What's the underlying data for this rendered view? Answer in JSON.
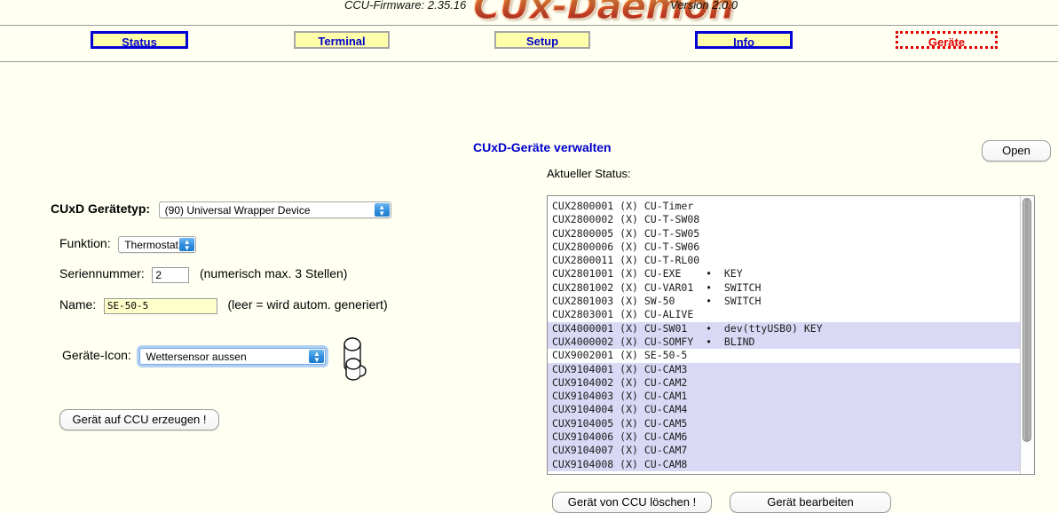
{
  "header": {
    "firmware": "CCU-Firmware: 2.35.16",
    "logo": "CUx-Daemon",
    "version": "Version 2.0.0"
  },
  "nav": {
    "tabs": [
      {
        "label": "Status",
        "state": "active"
      },
      {
        "label": "Terminal",
        "state": "plain"
      },
      {
        "label": "Setup",
        "state": "plain"
      },
      {
        "label": "Info",
        "state": "active"
      },
      {
        "label": "Geräte",
        "state": "dotted"
      }
    ]
  },
  "form": {
    "device_type_label": "CUxD Gerätetyp:",
    "device_type_value": "(90) Universal Wrapper Device",
    "function_label": "Funktion:",
    "function_value": "Thermostat",
    "serial_label": "Seriennummer:",
    "serial_value": "2",
    "serial_hint": "(numerisch max. 3 Stellen)",
    "name_label": "Name:",
    "name_value": "SE-50-5",
    "name_hint": "(leer = wird autom. generiert)",
    "icon_label": "Geräte-Icon:",
    "icon_value": "Wettersensor aussen",
    "create_button": "Gerät auf CCU erzeugen !"
  },
  "panel": {
    "title": "CUxD-Geräte verwalten",
    "open_button": "Open",
    "status_label": "Aktueller Status:",
    "delete_button": "Gerät von CCU löschen !",
    "edit_button": "Gerät bearbeiten",
    "rows": [
      {
        "text": "CUX2800001 (X) CU-Timer",
        "selected": false
      },
      {
        "text": "CUX2800002 (X) CU-T-SW08",
        "selected": false
      },
      {
        "text": "CUX2800005 (X) CU-T-SW05",
        "selected": false
      },
      {
        "text": "CUX2800006 (X) CU-T-SW06",
        "selected": false
      },
      {
        "text": "CUX2800011 (X) CU-T-RL00",
        "selected": false
      },
      {
        "text": "CUX2801001 (X) CU-EXE    •  KEY",
        "selected": false
      },
      {
        "text": "CUX2801002 (X) CU-VAR01  •  SWITCH",
        "selected": false
      },
      {
        "text": "CUX2801003 (X) SW-50     •  SWITCH",
        "selected": false
      },
      {
        "text": "CUX2803001 (X) CU-ALIVE",
        "selected": false
      },
      {
        "text": "CUX4000001 (X) CU-SW01   •  dev(ttyUSB0) KEY",
        "selected": true
      },
      {
        "text": "CUX4000002 (X) CU-SOMFY  •  BLIND",
        "selected": true
      },
      {
        "text": "CUX9002001 (X) SE-50-5",
        "selected": false
      },
      {
        "text": "CUX9104001 (X) CU-CAM3",
        "selected": true
      },
      {
        "text": "CUX9104002 (X) CU-CAM2",
        "selected": true
      },
      {
        "text": "CUX9104003 (X) CU-CAM1",
        "selected": true
      },
      {
        "text": "CUX9104004 (X) CU-CAM4",
        "selected": true
      },
      {
        "text": "CUX9104005 (X) CU-CAM5",
        "selected": true
      },
      {
        "text": "CUX9104006 (X) CU-CAM6",
        "selected": true
      },
      {
        "text": "CUX9104007 (X) CU-CAM7",
        "selected": true
      },
      {
        "text": "CUX9104008 (X) CU-CAM8",
        "selected": true
      }
    ]
  },
  "colors": {
    "page_background": "#fffff2",
    "tab_background": "#ffffaa",
    "tab_text": "#0000cc",
    "tab_active_border": "#0000d5",
    "geraete_tab": "#e00000",
    "selection": "#d9d9f5",
    "name_field": "#ffffcc"
  }
}
